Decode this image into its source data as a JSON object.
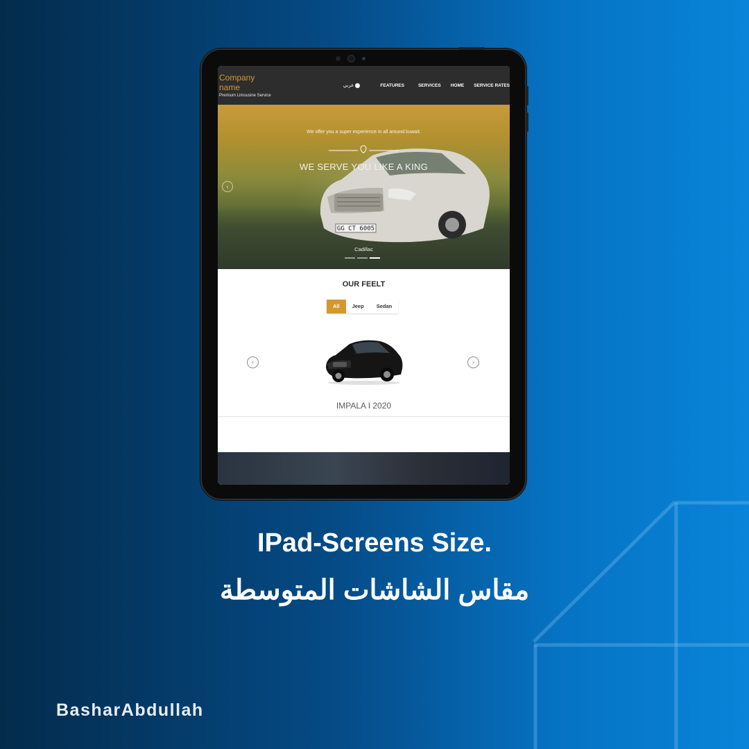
{
  "site": {
    "brand": {
      "name": "Company name",
      "tagline": "Premium Limousine Service"
    },
    "nav": {
      "language": "عربي",
      "items": [
        "FEATURES",
        "SERVICES",
        "HOME",
        "SERVICE RATES"
      ]
    },
    "hero": {
      "subtitle": "We offer you a super experience in all around kuwait.",
      "title": "WE SERVE YOU LIKE A KING",
      "caption": "Cadillac",
      "plate": "GG CT 6005",
      "slides": 3,
      "active_slide": 3
    },
    "fleet": {
      "title": "OUR FEELT",
      "filters": [
        "All",
        "Jeep",
        "Sedan"
      ],
      "active_filter": "All",
      "car_caption": "IMPALA I 2020"
    }
  },
  "poster": {
    "headline": "IPad-Screens Size.",
    "headline_ar": "مقاس الشاشات المتوسطة",
    "signature": "BasharAbdullah"
  },
  "colors": {
    "accent": "#d4982f",
    "header_bg": "#2d2d2d",
    "background_start": "#032b4c",
    "background_end": "#0884d8"
  }
}
